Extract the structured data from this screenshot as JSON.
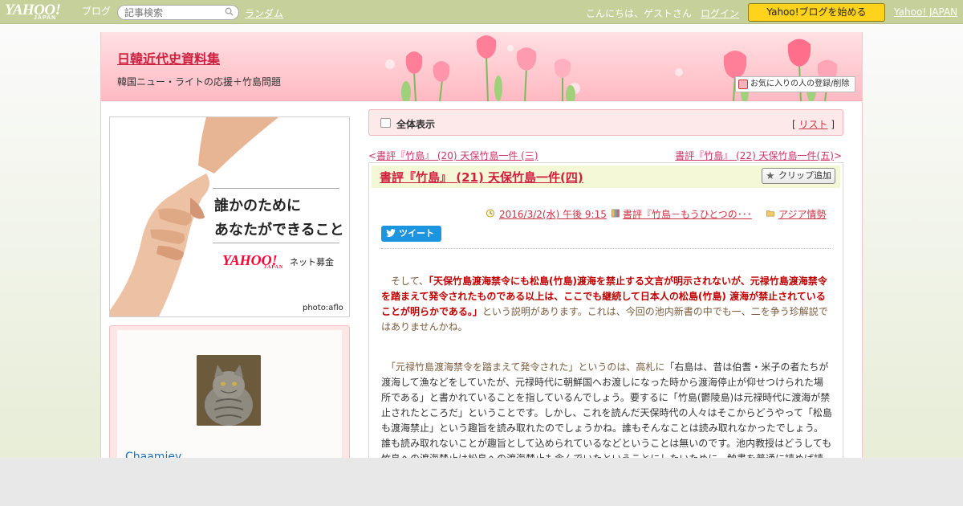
{
  "topbar": {
    "logo_text": "YAHOO!",
    "logo_sub": "JAPAN",
    "logo_blog": "ブログ",
    "search_placeholder": "記事検索",
    "random_link": "ランダム",
    "greeting": "こんにちは、ゲストさん",
    "login_link": "ログイン",
    "start_button": "Yahoo!ブログを始める",
    "yahoo_japan_link": "Yahoo! JAPAN"
  },
  "header": {
    "blog_title": "日韓近代史資料集",
    "blog_description": "韓国ニュー・ライトの応援＋竹島問題",
    "favorite_button": "お気に入りの人の登録/削除"
  },
  "ad": {
    "line1": "誰かのために",
    "line2": "あなたができること",
    "logo": "YAHOO!",
    "logo_sub": "JAPAN",
    "service": "ネット募金",
    "credit": "photo:aflo"
  },
  "profile": {
    "username": "Chaamiey"
  },
  "viewbar": {
    "label": "全体表示",
    "list_open": "[ ",
    "list_link": "リスト",
    "list_close": " ]"
  },
  "nav": {
    "prev_arrow": "<",
    "prev": "書評『竹島』 (20) 天保竹島一件 (三)",
    "next": "書評『竹島』 (22) 天保竹島一件(五)",
    "next_arrow": ">"
  },
  "article": {
    "title": "書評『竹島』 (21) 天保竹島一件(四)",
    "clip_button": "クリップ追加",
    "date": "2016/3/2(水) 午後 9:15",
    "book_category": "書評『竹島－もうひとつの･･･",
    "folder": "アジア情勢",
    "tweet_button": "ツイート",
    "p1_intro": "　そして、",
    "p1_quote": "「天保竹島渡海禁令にも松島(竹島)渡海を禁止する文言が明示されないが、元禄竹島渡海禁令を踏まえて発令されたものである以上は、ここでも継続して日本人の松島(竹島) 渡海が禁止されていることが明らかである。」",
    "p1_rest": "という説明があります。これは、今回の池内新書の中でも一、二を争う珍解説ではありませんかね。",
    "p2_quote": "　「元禄竹島渡海禁令を踏まえて発令された」というのは、高札に",
    "p2_rest": "「右島は、昔は伯耆・米子の者たちが渡海して漁などをしていたが、元禄時代に朝鮮国へお渡しになった時から渡海停止が仰せつけられた場所である」と書かれていることを指しているんでしょう。要するに「竹島(鬱陵島)は元禄時代に渡海が禁止されたところだ」ということです。しかし、これを読んだ天保時代の人々はそこからどうやって「松島も渡海禁止」という趣旨を読み取れたのでしょうかね。誰もそんなことは読み取れなかったでしょう。誰も読み取れないことが趣旨として込められているなどということは無いのです。池内教授はどうしても竹島への渡海禁止は松島への渡海禁止も含んでいたということにしたいために、触書を普通に読めば読み取れないような趣旨を無理やり想定しているのです。"
  },
  "colors": {
    "topbar_bg": "#c6d09a",
    "header_pink": "#ffb9c3",
    "link_red": "#d02040",
    "accent_yellow": "#ffd21b"
  }
}
